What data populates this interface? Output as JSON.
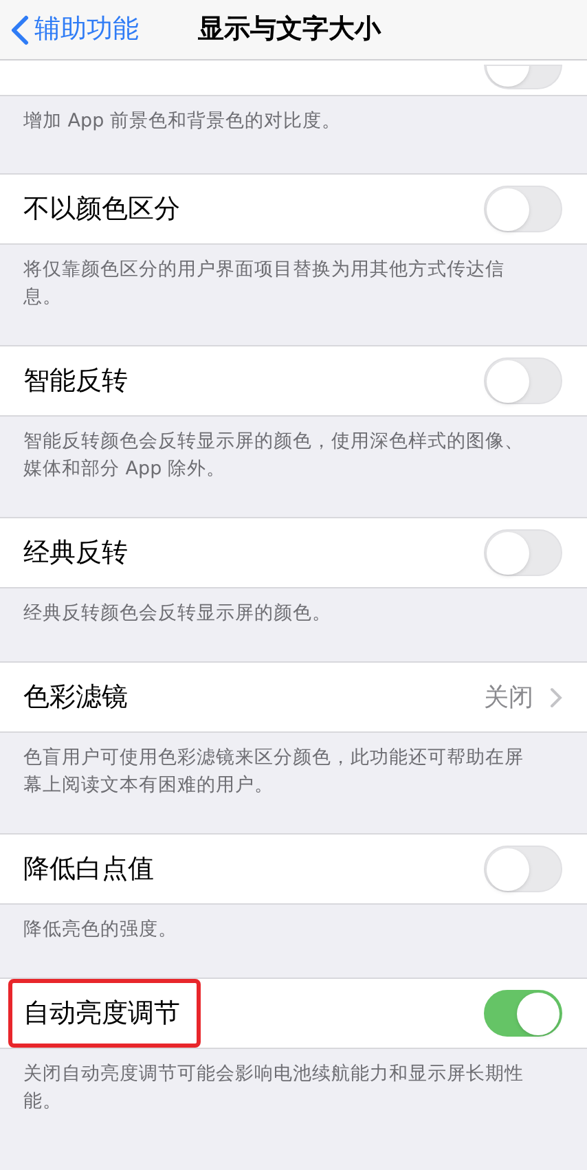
{
  "nav": {
    "back": "辅助功能",
    "title": "显示与文字大小"
  },
  "groups": [
    {
      "kind": "toggle",
      "on": false,
      "footer": "增加 App 前景色和背景色的对比度。"
    },
    {
      "kind": "toggle",
      "label": "不以颜色区分",
      "on": false,
      "highlighted": false,
      "footer": "将仅靠颜色区分的用户界面项目替换为用其他方式传达信息。"
    },
    {
      "kind": "toggle",
      "label": "智能反转",
      "on": false,
      "highlighted": false,
      "footer": "智能反转颜色会反转显示屏的颜色，使用深色样式的图像、媒体和部分 App 除外。"
    },
    {
      "kind": "toggle",
      "label": "经典反转",
      "on": false,
      "highlighted": false,
      "footer": "经典反转颜色会反转显示屏的颜色。"
    },
    {
      "kind": "disclosure",
      "label": "色彩滤镜",
      "value": "关闭",
      "highlighted": false,
      "footer": "色盲用户可使用色彩滤镜来区分颜色，此功能还可帮助在屏幕上阅读文本有困难的用户。"
    },
    {
      "kind": "toggle",
      "label": "降低白点值",
      "on": false,
      "highlighted": false,
      "footer": "降低亮色的强度。"
    },
    {
      "kind": "toggle",
      "label": "自动亮度调节",
      "on": true,
      "highlighted": true,
      "footer": "关闭自动亮度调节可能会影响电池续航能力和显示屏长期性能。"
    }
  ]
}
